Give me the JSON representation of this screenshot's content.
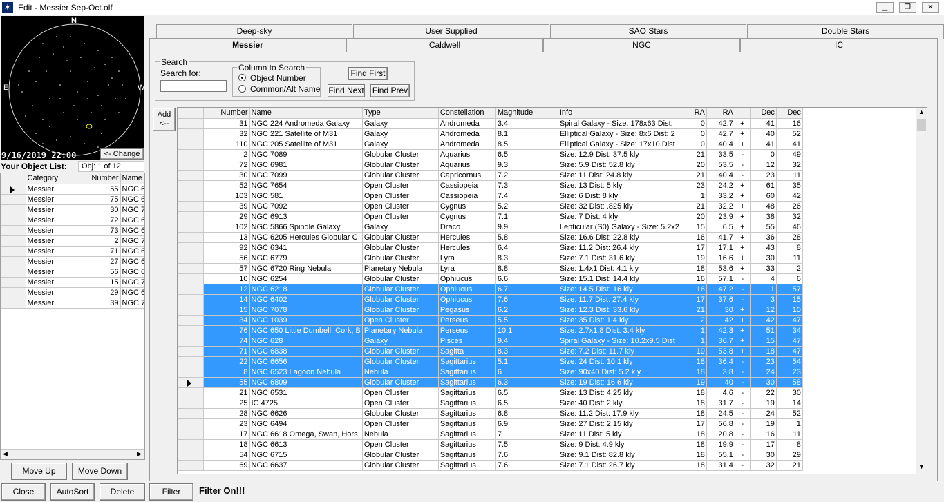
{
  "window": {
    "title": "Edit - Messier Sep-Oct.olf",
    "minimize": "▁",
    "restore": "❐",
    "close": "✕"
  },
  "sky": {
    "datetime": "9/16/2019 22:00",
    "change_label": "<- Change",
    "north": "N",
    "east": "E",
    "west": "W"
  },
  "objectlist": {
    "label": "Your Object List:",
    "position": "Obj: 1 of 12",
    "headers": [
      "Category",
      "Number",
      "Name"
    ],
    "rows": [
      [
        "Messier",
        "55",
        "NGC 6"
      ],
      [
        "Messier",
        "75",
        "NGC 6"
      ],
      [
        "Messier",
        "30",
        "NGC 7"
      ],
      [
        "Messier",
        "72",
        "NGC 6"
      ],
      [
        "Messier",
        "73",
        "NGC 6"
      ],
      [
        "Messier",
        "2",
        "NGC 7"
      ],
      [
        "Messier",
        "71",
        "NGC 6"
      ],
      [
        "Messier",
        "27",
        "NGC 6"
      ],
      [
        "Messier",
        "56",
        "NGC 6"
      ],
      [
        "Messier",
        "15",
        "NGC 7"
      ],
      [
        "Messier",
        "29",
        "NGC 6"
      ],
      [
        "Messier",
        "39",
        "NGC 7"
      ]
    ]
  },
  "buttons": {
    "move_up": "Move Up",
    "move_down": "Move Down",
    "close": "Close",
    "autosort": "AutoSort",
    "delete": "Delete",
    "filter": "Filter",
    "add": "Add\n<--",
    "find_first": "Find First",
    "find_next": "Find Next",
    "find_prev": "Find Prev"
  },
  "filter_status": "Filter On!!!",
  "tabs_back": [
    "Deep-sky",
    "User Supplied",
    "SAO Stars",
    "Double Stars"
  ],
  "tabs_front": [
    "Messier",
    "Caldwell",
    "NGC",
    "IC"
  ],
  "search": {
    "group_label": "Search",
    "search_for_label": "Search for:",
    "search_value": "",
    "column_group": "Column to Search",
    "option1": "Object Number",
    "option2": "Common/Alt Name",
    "selected": "Object Number"
  },
  "table": {
    "headers": [
      "Number",
      "Name",
      "Type",
      "Constellation",
      "Magnitude",
      "Info",
      "RA",
      "RA",
      "",
      "Dec",
      "Dec"
    ],
    "rows": [
      {
        "c": [
          "31",
          "NGC 224 Andromeda Galaxy",
          "Galaxy",
          "Andromeda",
          "3.4",
          "Spiral Galaxy - Size: 178x63  Dist:",
          "0",
          "42.7",
          "+",
          "41",
          "16"
        ]
      },
      {
        "c": [
          "32",
          "NGC 221 Satellite of M31",
          "Galaxy",
          "Andromeda",
          "8.1",
          "Elliptical Galaxy - Size: 8x6  Dist: 2",
          "0",
          "42.7",
          "+",
          "40",
          "52"
        ]
      },
      {
        "c": [
          "110",
          "NGC 205 Satellite of M31",
          "Galaxy",
          "Andromeda",
          "8.5",
          "Elliptical Galaxy - Size: 17x10  Dist",
          "0",
          "40.4",
          "+",
          "41",
          "41"
        ]
      },
      {
        "c": [
          "2",
          "NGC 7089",
          "Globular Cluster",
          "Aquarius",
          "6.5",
          "Size: 12.9  Dist: 37.5 kly",
          "21",
          "33.5",
          "-",
          "0",
          "49"
        ]
      },
      {
        "c": [
          "72",
          "NGC 6981",
          "Globular Cluster",
          "Aquarius",
          "9.3",
          "Size: 5.9  Dist: 52.8 kly",
          "20",
          "53.5",
          "-",
          "12",
          "32"
        ]
      },
      {
        "c": [
          "30",
          "NGC 7099",
          "Globular Cluster",
          "Capricornus",
          "7.2",
          "Size: 11  Dist: 24.8 kly",
          "21",
          "40.4",
          "-",
          "23",
          "11"
        ]
      },
      {
        "c": [
          "52",
          "NGC 7654",
          "Open Cluster",
          "Cassiopeia",
          "7.3",
          "Size: 13  Dist: 5 kly",
          "23",
          "24.2",
          "+",
          "61",
          "35"
        ]
      },
      {
        "c": [
          "103",
          "NGC 581",
          "Open Cluster",
          "Cassiopeia",
          "7.4",
          "Size: 6  Dist: 8 kly",
          "1",
          "33.2",
          "+",
          "60",
          "42"
        ]
      },
      {
        "c": [
          "39",
          "NGC 7092",
          "Open Cluster",
          "Cygnus",
          "5.2",
          "Size: 32  Dist: .825 kly",
          "21",
          "32.2",
          "+",
          "48",
          "26"
        ]
      },
      {
        "c": [
          "29",
          "NGC 6913",
          "Open Cluster",
          "Cygnus",
          "7.1",
          "Size: 7  Dist: 4 kly",
          "20",
          "23.9",
          "+",
          "38",
          "32"
        ]
      },
      {
        "c": [
          "102",
          "NGC 5866 Spindle Galaxy",
          "Galaxy",
          "Draco",
          "9.9",
          "Lenticular (S0) Galaxy - Size: 5.2x2",
          "15",
          "6.5",
          "+",
          "55",
          "46"
        ]
      },
      {
        "c": [
          "13",
          "NGC 6205 Hercules Globular C",
          "Globular Cluster",
          "Hercules",
          "5.8",
          "Size: 16.6  Dist: 22.8 kly",
          "16",
          "41.7",
          "+",
          "36",
          "28"
        ]
      },
      {
        "c": [
          "92",
          "NGC 6341",
          "Globular Cluster",
          "Hercules",
          "6.4",
          "Size: 11.2  Dist: 26.4 kly",
          "17",
          "17.1",
          "+",
          "43",
          "8"
        ]
      },
      {
        "c": [
          "56",
          "NGC 6779",
          "Globular Cluster",
          "Lyra",
          "8.3",
          "Size: 7.1  Dist: 31.6 kly",
          "19",
          "16.6",
          "+",
          "30",
          "11"
        ]
      },
      {
        "c": [
          "57",
          "NGC 6720 Ring Nebula",
          "Planetary Nebula",
          "Lyra",
          "8.8",
          "Size: 1.4x1  Dist: 4.1 kly",
          "18",
          "53.6",
          "+",
          "33",
          "2"
        ]
      },
      {
        "c": [
          "10",
          "NGC 6254",
          "Globular Cluster",
          "Ophiucus",
          "6.6",
          "Size: 15.1  Dist: 14.4 kly",
          "16",
          "57.1",
          "-",
          "4",
          "6"
        ]
      },
      {
        "c": [
          "12",
          "NGC 6218",
          "Globular Cluster",
          "Ophiucus",
          "6.7",
          "Size: 14.5  Dist: 16 kly",
          "16",
          "47.2",
          "-",
          "1",
          "57"
        ],
        "sel": true
      },
      {
        "c": [
          "14",
          "NGC 6402",
          "Globular Cluster",
          "Ophiucus",
          "7.6",
          "Size: 11.7  Dist: 27.4 kly",
          "17",
          "37.6",
          "-",
          "3",
          "15"
        ],
        "sel": true
      },
      {
        "c": [
          "15",
          "NGC 7078",
          "Globular Cluster",
          "Pegasus",
          "6.2",
          "Size: 12.3  Dist: 33.6 kly",
          "21",
          "30",
          "+",
          "12",
          "10"
        ],
        "sel": true
      },
      {
        "c": [
          "34",
          "NGC 1039",
          "Open Cluster",
          "Perseus",
          "5.5",
          "Size: 35  Dist: 1.4 kly",
          "2",
          "42",
          "+",
          "42",
          "47"
        ],
        "sel": true
      },
      {
        "c": [
          "76",
          "NGC 650 Little Dumbell, Cork, B",
          "Planetary Nebula",
          "Perseus",
          "10.1",
          "Size: 2.7x1.8  Dist: 3.4 kly",
          "1",
          "42.3",
          "+",
          "51",
          "34"
        ],
        "sel": true
      },
      {
        "c": [
          "74",
          "NGC 628",
          "Galaxy",
          "Pisces",
          "9.4",
          "Spiral Galaxy - Size: 10.2x9.5  Dist",
          "1",
          "36.7",
          "+",
          "15",
          "47"
        ],
        "sel": true
      },
      {
        "c": [
          "71",
          "NGC 6838",
          "Globular Cluster",
          "Sagitta",
          "8.3",
          "Size: 7.2  Dist: 11.7 kly",
          "19",
          "53.8",
          "+",
          "18",
          "47"
        ],
        "sel": true
      },
      {
        "c": [
          "22",
          "NGC 6656",
          "Globular Cluster",
          "Sagittarius",
          "5.1",
          "Size: 24  Dist: 10.1 kly",
          "18",
          "36.4",
          "-",
          "23",
          "54"
        ],
        "sel": true
      },
      {
        "c": [
          "8",
          "NGC 6523 Lagoon Nebula",
          "Nebula",
          "Sagittarius",
          "6",
          "Size: 90x40  Dist: 5.2 kly",
          "18",
          "3.8",
          "-",
          "24",
          "23"
        ],
        "sel": true
      },
      {
        "c": [
          "55",
          "NGC 6809",
          "Globular Cluster",
          "Sagittarius",
          "6.3",
          "Size: 19  Dist: 16.6 kly",
          "19",
          "40",
          "-",
          "30",
          "58"
        ],
        "sel": true,
        "cur": true
      },
      {
        "c": [
          "21",
          "NGC 6531",
          "Open Cluster",
          "Sagittarius",
          "6.5",
          "Size: 13  Dist: 4.25 kly",
          "18",
          "4.6",
          "-",
          "22",
          "30"
        ]
      },
      {
        "c": [
          "25",
          "IC 4725",
          "Open Cluster",
          "Sagittarius",
          "6.5",
          "Size: 40  Dist: 2 kly",
          "18",
          "31.7",
          "-",
          "19",
          "14"
        ]
      },
      {
        "c": [
          "28",
          "NGC 6626",
          "Globular Cluster",
          "Sagittarius",
          "6.8",
          "Size: 11.2  Dist: 17.9 kly",
          "18",
          "24.5",
          "-",
          "24",
          "52"
        ]
      },
      {
        "c": [
          "23",
          "NGC 6494",
          "Open Cluster",
          "Sagittarius",
          "6.9",
          "Size: 27  Dist: 2.15 kly",
          "17",
          "56.8",
          "-",
          "19",
          "1"
        ]
      },
      {
        "c": [
          "17",
          "NGC 6618 Omega, Swan, Hors",
          "Nebula",
          "Sagittarius",
          "7",
          "Size: 11  Dist: 5 kly",
          "18",
          "20.8",
          "-",
          "16",
          "11"
        ]
      },
      {
        "c": [
          "18",
          "NGC 6613",
          "Open Cluster",
          "Sagittarius",
          "7.5",
          "Size: 9  Dist: 4.9 kly",
          "18",
          "19.9",
          "-",
          "17",
          "8"
        ]
      },
      {
        "c": [
          "54",
          "NGC 6715",
          "Globular Cluster",
          "Sagittarius",
          "7.6",
          "Size: 9.1  Dist: 82.8 kly",
          "18",
          "55.1",
          "-",
          "30",
          "29"
        ]
      },
      {
        "c": [
          "69",
          "NGC 6637",
          "Globular Cluster",
          "Sagittarius",
          "7.6",
          "Size: 7.1  Dist: 26.7 kly",
          "18",
          "31.4",
          "-",
          "32",
          "21"
        ]
      }
    ]
  }
}
